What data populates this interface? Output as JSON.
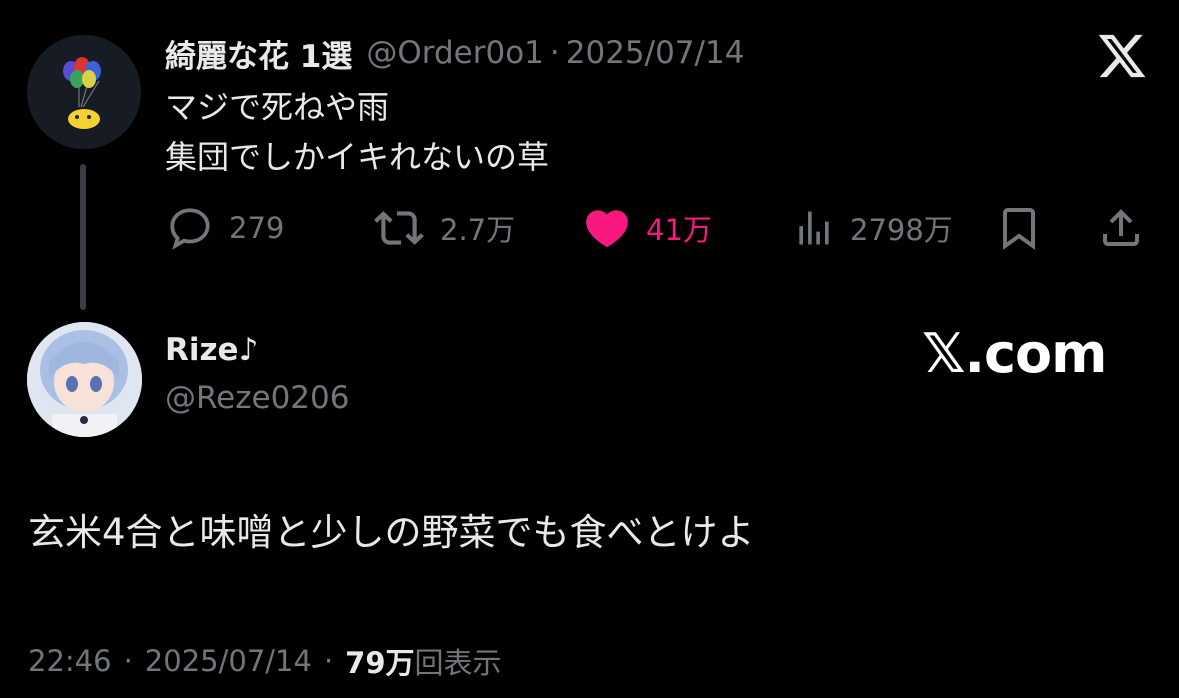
{
  "tweet1": {
    "author_name": "綺麗な花 1選",
    "handle": "@Order0o1",
    "separator": "·",
    "date": "2025/07/14",
    "lines": [
      "マジで死ねや雨",
      "集団でしかイキれないの草"
    ],
    "actions": {
      "replies": "279",
      "retweets": "2.7万",
      "likes": "41万",
      "views": "2798万"
    },
    "liked": true,
    "like_color": "#f91880"
  },
  "tweet2": {
    "author_name": "Rize♪",
    "handle": "@Reze0206",
    "text": "玄米4合と味噌と少しの野菜でも食べとけよ",
    "time": "22:46",
    "separator": "·",
    "date": "2025/07/14",
    "views_count": "79万",
    "views_label": "回表示"
  },
  "watermark": "𝕏.com",
  "icons": [
    "x-logo-icon",
    "reply-icon",
    "retweet-icon",
    "like-heart-icon",
    "views-chart-icon",
    "bookmark-icon",
    "share-icon"
  ]
}
